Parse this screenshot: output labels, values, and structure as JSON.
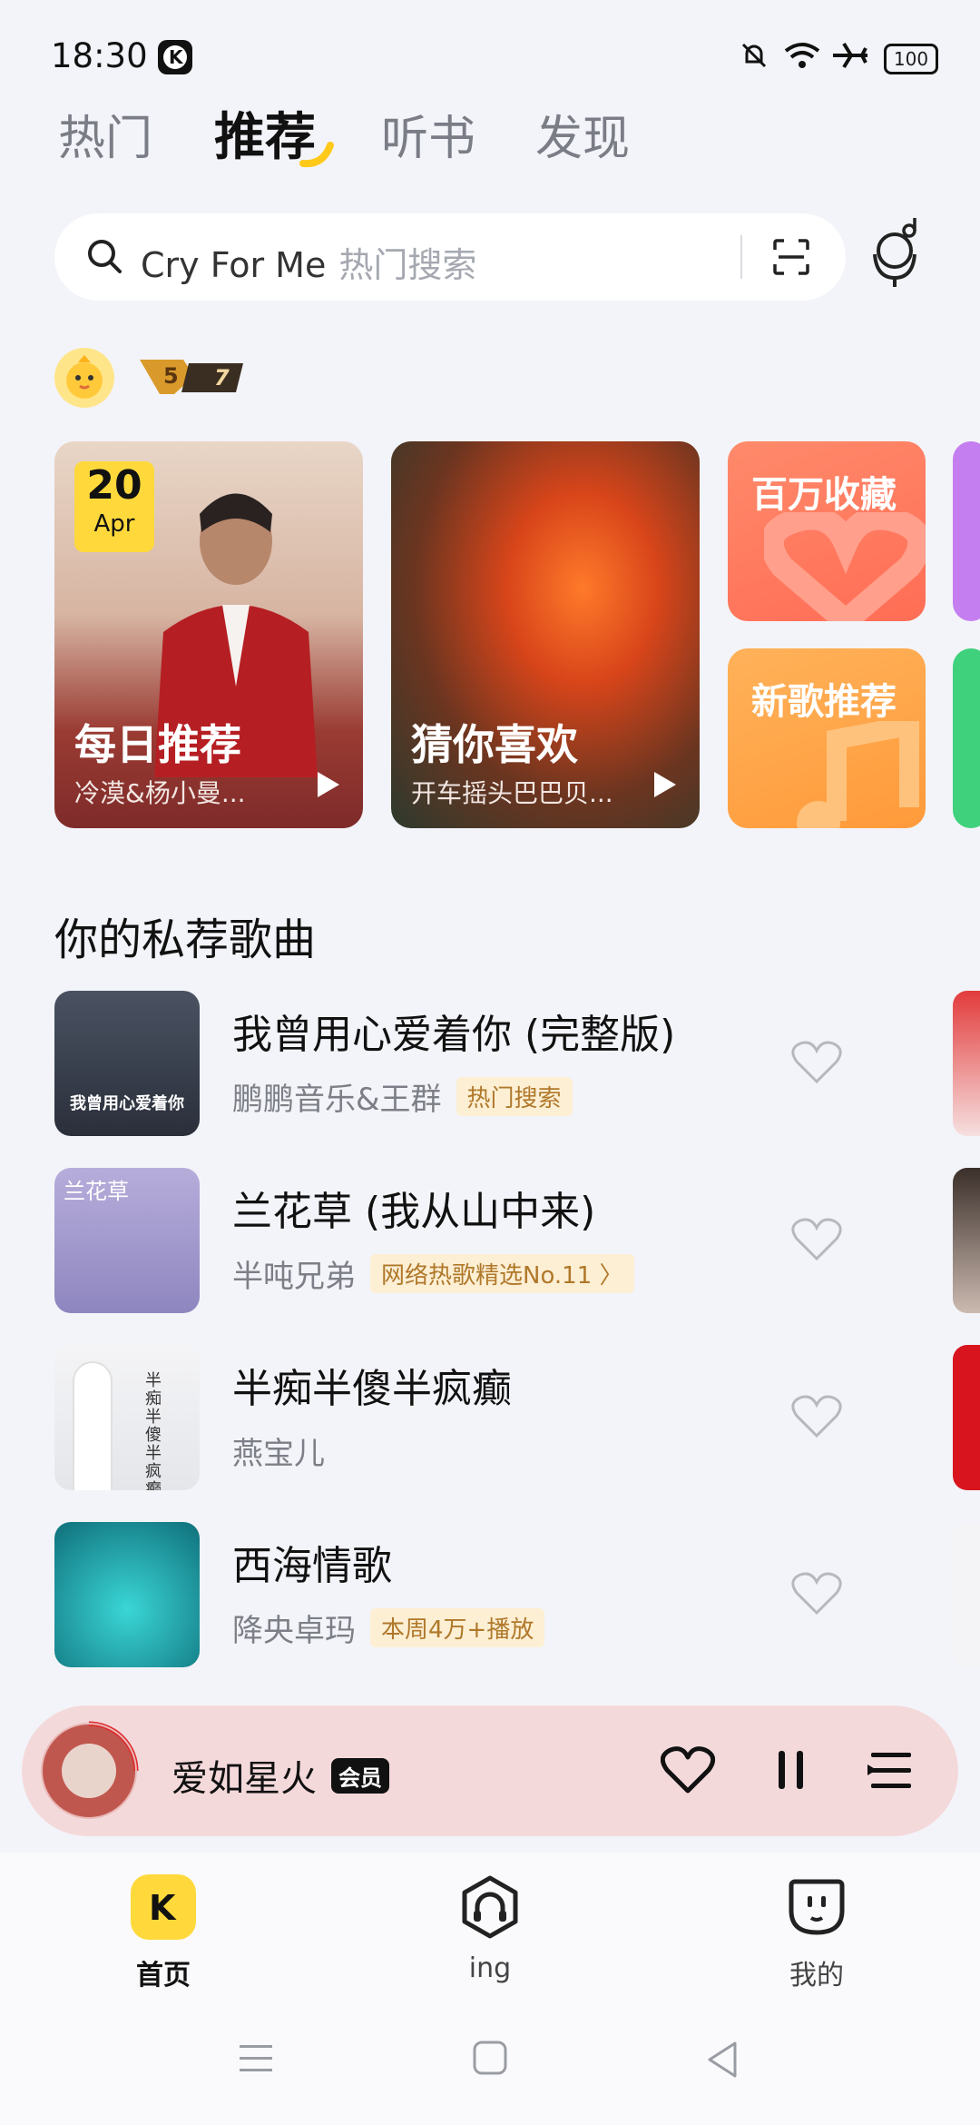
{
  "status_bar": {
    "time": "18:30",
    "battery": "100"
  },
  "tabs": [
    {
      "label": "热门",
      "active": false
    },
    {
      "label": "推荐",
      "active": true
    },
    {
      "label": "听书",
      "active": false
    },
    {
      "label": "发现",
      "active": false
    }
  ],
  "search": {
    "query": "Cry For Me",
    "placeholder": "热门搜索"
  },
  "user": {
    "level_badge": "5",
    "level_count": "7"
  },
  "cards": {
    "daily": {
      "day": "20",
      "month": "Apr",
      "title": "每日推荐",
      "subtitle": "冷漠&杨小曼..."
    },
    "guess": {
      "title": "猜你喜欢",
      "subtitle": "开车摇头巴巴贝..."
    },
    "million": {
      "title": "百万收藏"
    },
    "new_songs": {
      "title": "新歌推荐"
    }
  },
  "section": {
    "title": "你的私荐歌曲"
  },
  "songs": [
    {
      "title": "我曾用心爱着你 (完整版)",
      "artist": "鹏鹏音乐&王群",
      "tag": "热门搜索",
      "cover_text": "我曾用心爱着你"
    },
    {
      "title": "兰花草 (我从山中来)",
      "artist": "半吨兄弟",
      "tag": "网络热歌精选No.11 〉",
      "cover_text": "兰花草"
    },
    {
      "title": "半痴半傻半疯癫",
      "artist": "燕宝儿",
      "tag": "",
      "cover_text": "半痴半傻半疯癫"
    },
    {
      "title": "西海情歌",
      "artist": "降央卓玛",
      "tag": "本周4万+播放",
      "cover_text": ""
    }
  ],
  "player": {
    "title": "爱如星火",
    "badge": "会员"
  },
  "nav": [
    {
      "label": "首页",
      "active": true
    },
    {
      "label": "ing",
      "active": false
    },
    {
      "label": "我的",
      "active": false
    }
  ],
  "colors": {
    "accent_yellow": "#ffd93b",
    "tag_bg": "#fcefd4",
    "tag_text": "#b0782a",
    "player_bg": "#f4d9db"
  }
}
